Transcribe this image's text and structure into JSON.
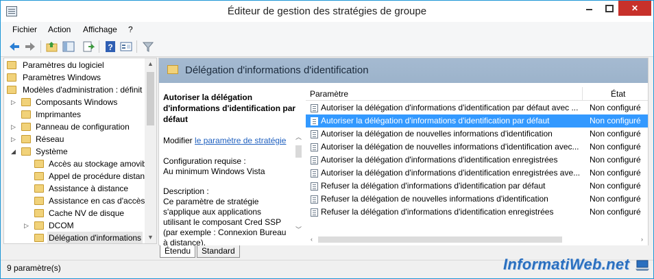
{
  "window": {
    "title": "Éditeur de gestion des stratégies de groupe",
    "close_glyph": "✕"
  },
  "menu": [
    "Fichier",
    "Action",
    "Affichage",
    "?"
  ],
  "toolbar": {
    "icons": [
      "back-arrow-icon",
      "forward-arrow-icon",
      "up-folder-icon",
      "show-hide-tree-icon",
      "export-list-icon",
      "help-icon",
      "properties-icon",
      "filter-icon"
    ]
  },
  "tree": {
    "items": [
      {
        "label": "Paramètres du logiciel",
        "expander": ""
      },
      {
        "label": "Paramètres Windows",
        "expander": ""
      },
      {
        "label": "Modèles d'administration : définit",
        "expander": ""
      },
      {
        "label": "Composants Windows",
        "expander": "▷"
      },
      {
        "label": "Imprimantes",
        "expander": ""
      },
      {
        "label": "Panneau de configuration",
        "expander": "▷"
      },
      {
        "label": "Réseau",
        "expander": "▷"
      },
      {
        "label": "Système",
        "expander": "◢"
      },
      {
        "label": "Accès au stockage amovib",
        "expander": ""
      },
      {
        "label": "Appel de procédure distant",
        "expander": ""
      },
      {
        "label": "Assistance à distance",
        "expander": ""
      },
      {
        "label": "Assistance en cas d'accès r",
        "expander": ""
      },
      {
        "label": "Cache NV de disque",
        "expander": ""
      },
      {
        "label": "DCOM",
        "expander": "▷"
      },
      {
        "label": "Délégation d'informations",
        "expander": ""
      }
    ]
  },
  "pane": {
    "header_title": "Délégation d'informations d'identification",
    "policy_title": "Autoriser la délégation d'informations d'identification par défaut",
    "modify_prefix": "Modifier",
    "modify_link": "le paramètre de stratégie",
    "requirement_label": "Configuration requise :",
    "requirement_value": "Au minimum Windows Vista",
    "description_label": "Description :",
    "description_text": "Ce paramètre de stratégie s'applique aux applications utilisant le composant Cred SSP (par exemple : Connexion Bureau à distance)."
  },
  "list": {
    "col_setting": "Paramètre",
    "col_state": "État",
    "rows": [
      {
        "name": "Autoriser la délégation d'informations d'identification par défaut avec ...",
        "state": "Non configuré",
        "selected": false
      },
      {
        "name": "Autoriser la délégation d'informations d'identification par défaut",
        "state": "Non configuré",
        "selected": true
      },
      {
        "name": "Autoriser la délégation de nouvelles informations d'identification",
        "state": "Non configuré",
        "selected": false
      },
      {
        "name": "Autoriser la délégation de nouvelles informations d'identification avec...",
        "state": "Non configuré",
        "selected": false
      },
      {
        "name": "Autoriser la délégation d'informations d'identification enregistrées",
        "state": "Non configuré",
        "selected": false
      },
      {
        "name": "Autoriser la délégation d'informations d'identification enregistrées ave...",
        "state": "Non configuré",
        "selected": false
      },
      {
        "name": "Refuser la délégation d'informations d'identification par défaut",
        "state": "Non configuré",
        "selected": false
      },
      {
        "name": "Refuser la délégation de nouvelles informations d'identification",
        "state": "Non configuré",
        "selected": false
      },
      {
        "name": "Refuser la délégation d'informations d'identification enregistrées",
        "state": "Non configuré",
        "selected": false
      }
    ]
  },
  "tabs": [
    "Étendu",
    "Standard"
  ],
  "status": {
    "count": "9 paramètre(s)"
  },
  "watermark": "InformatiWeb.net",
  "colors": {
    "accent": "#1c96d6",
    "selection": "#3399ff",
    "header_band": "#a5bad1",
    "link": "#1e5fbf",
    "close": "#c7312b"
  }
}
